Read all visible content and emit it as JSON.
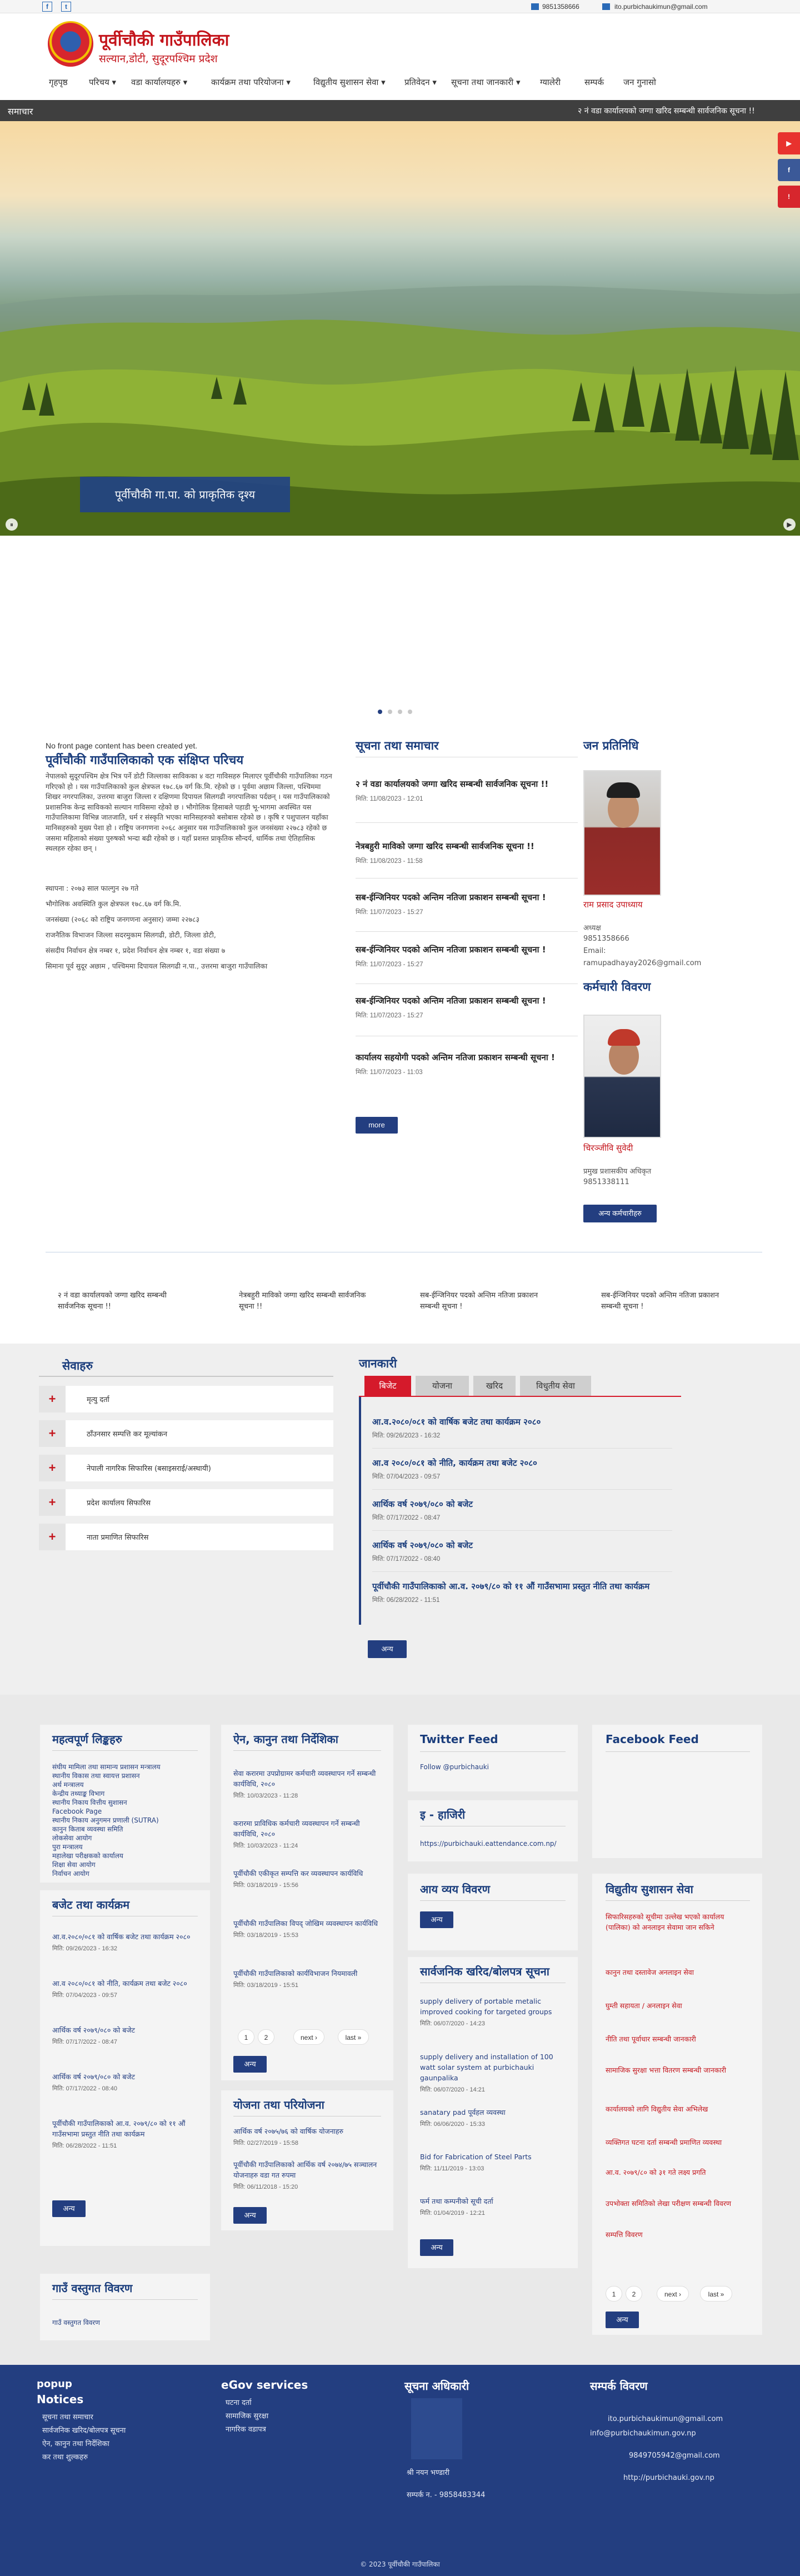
{
  "topbar": {
    "phone": "9851358666",
    "email": "ito.purbichaukimun@gmail.com"
  },
  "header": {
    "title": "पूर्वीचौकी गाउँपालिका",
    "subtitle": "सल्यान,डोटी, सुदूरपश्चिम प्रदेश"
  },
  "nav": [
    "गृहपृष्ठ",
    "परिचय ▾",
    "वडा कार्यालयहरु ▾",
    "कार्यक्रम तथा परियोजना ▾",
    "विद्युतीय सुशासन सेवा ▾",
    "प्रतिवेदन ▾",
    "सूचना तथा जानकारी ▾",
    "ग्यालेरी",
    "सम्पर्क",
    "जन गुनासो"
  ],
  "ticker": {
    "label": "समाचार",
    "text": "२ नं वडा कार्यालयको जग्गा खरिद सम्बन्धी सार्वजनिक सूचना !!"
  },
  "hero": {
    "caption": "पूर्वीचौकी गा.पा. को प्राकृतिक दृश्य"
  },
  "side_buttons": [
    "YouTube",
    "Facebook",
    "Alert"
  ],
  "intro": {
    "lead": "No front page content has been created yet.",
    "title": "पूर्वीचौकी गाउँपालिकाको एक संक्षिप्त परिचय",
    "body": "नेपालको सुदूरपश्चिम क्षेत्र भित्र पर्ने डोटी जिल्लाका साविकका ४ वटा गाविसहरु मिलाएर पूर्वीचौकी गाउँपालिका गठन गरिएको हो । यस गाउँपालिकाको कुल क्षेत्रफल १७८.६७ वर्ग कि.मि. रहेको छ । पूर्वमा अछाम जिल्ला, पश्चिममा शिखर नगरपालिका, उत्तरमा बाजुरा जिल्ला र दक्षिणमा दिपायल सिलगढी नगरपालिका पर्दछन् । यस गाउँपालिकाको प्रशासनिक केन्द्र साविकको सल्यान गाविसमा रहेको छ । भौगोलिक हिसाबले पहाडी भू-भागमा अवस्थित यस गाउँपालिकामा विभिन्न जातजाति, धर्म र संस्कृति भएका मानिसहरुको बसोबास रहेको छ । कृषि र पशुपालन यहाँका मानिसहरुको मुख्य पेशा हो । राष्ट्रिय जनगणना २०६८ अनुसार यस गाउँपालिकाको कुल जनसंख्या २२७८३ रहेको छ जसमा महिलाको संख्या पुरुषको भन्दा बढी रहेको छ । यहाँ प्रशस्त प्राकृतिक सौन्दर्य, धार्मिक तथा ऐतिहासिक स्थलहरु रहेका छन् ।",
    "lines": [
      "स्थापना : २०७३ साल फाल्गुन २७ गते",
      "भौगोलिक अवस्थिति कुल क्षेत्रफल १७८.६७ वर्ग कि.मि.",
      "जनसंख्या (२०६८ को राष्ट्रिय जनगणना अनुसार) जम्मा २२७८३",
      "राजनैतिक विभाजन जिल्ला सदरमुकाम सिलगढी, डोटी, जिल्ला डोटी,",
      "संसदीय निर्वाचन क्षेत्र नम्बर १, प्रदेश निर्वाचन क्षेत्र नम्बर १, वडा संख्या ७",
      "सिमाना पूर्व सुदूर अछाम , पश्चिममा दिपायल सिलगढी न.पा., उत्तरमा बाजुरा गाउँपालिका"
    ]
  },
  "news": {
    "heading": "सूचना तथा समाचार",
    "items": [
      {
        "title": "२ नं वडा कार्यालयको जग्गा खरिद सम्बन्धी सार्वजनिक सूचना !!",
        "date": "मिति: 11/08/2023 - 12:01"
      },
      {
        "title": "नेत्रबहुरी माविको जग्गा खरिद सम्बन्धी सार्वजनिक सूचना !!",
        "date": "मिति: 11/08/2023 - 11:58"
      },
      {
        "title": "सब-ईन्जिनियर पदको अन्तिम नतिजा प्रकाशन सम्बन्धी सूचना !",
        "date": "मिति: 11/07/2023 - 15:27"
      },
      {
        "title": "सब-ईन्जिनियर पदको अन्तिम नतिजा प्रकाशन सम्बन्धी सूचना !",
        "date": "मिति: 11/07/2023 - 15:27"
      },
      {
        "title": "सब-ईन्जिनियर पदको अन्तिम नतिजा प्रकाशन सम्बन्धी सूचना !",
        "date": "मिति: 11/07/2023 - 15:27"
      },
      {
        "title": "कार्यालय सहयोगी पदको अन्तिम नतिजा प्रकाशन सम्बन्धी सूचना !",
        "date": "मिति: 11/07/2023 - 11:03"
      }
    ],
    "more": "more"
  },
  "representative": {
    "heading": "जन प्रतिनिधि",
    "name": "राम प्रसाद उपाध्याय",
    "role": "अध्यक्ष",
    "phone": "9851358666",
    "email_label": "Email:",
    "email": "ramupadhayay2026@gmail.com"
  },
  "staff": {
    "heading": "कर्मचारी विवरण",
    "name": "चिरञ्जीवि सुवेदी",
    "role": "प्रमुख प्रशासकीय अधिकृत",
    "phone": "9851338111",
    "more": "अन्य कर्मचारीहरु"
  },
  "strip": [
    "२ नं वडा कार्यालयको जग्गा खरिद सम्बन्धी सार्वजनिक सूचना !!",
    "नेत्रबहुरी माविको जग्गा खरिद सम्बन्धी सार्वजनिक सूचना !!",
    "सब-ईन्जिनियर पदको अन्तिम नतिजा प्रकाशन सम्बन्धी सूचना !",
    "सब-ईन्जिनियर पदको अन्तिम नतिजा प्रकाशन सम्बन्धी सूचना !"
  ],
  "services": {
    "heading": "सेवाहरु",
    "items": [
      "मृत्यु दर्ता",
      "ठाँउनसार सम्पत्ति कर मूल्यांकन",
      "नेपाली नागरिक सिफारिस (बसाइसराई/अस्थायी)",
      "प्रदेश कार्यालय सिफारिस",
      "नाता प्रमाणित सिफारिस"
    ]
  },
  "info": {
    "heading": "जानकारी",
    "tabs": [
      "बिजेट",
      "योजना",
      "खरिद",
      "विधुतीय सेवा"
    ],
    "items": [
      {
        "title": "आ.व.२०८०/०८१ को वार्षिक बजेट तथा कार्यक्रम २०८०",
        "date": "मिति: 09/26/2023 - 16:32"
      },
      {
        "title": "आ.व २०८०/०८१ को नीति, कार्यक्रम तथा बजेट २०८०",
        "date": "मिति: 07/04/2023 - 09:57"
      },
      {
        "title": "आर्थिक वर्ष २०७९/०८० को बजेट",
        "date": "मिति: 07/17/2022 - 08:47"
      },
      {
        "title": "आर्थिक वर्ष २०७९/०८० को बजेट",
        "date": "मिति: 07/17/2022 - 08:40"
      },
      {
        "title": "पूर्वीचौकी गाउँपालिकाको आ.व. २०७९/८० को ११ औं गाउँसभामा प्रस्तुत नीति तथा कार्यक्रम",
        "date": "मिति: 06/28/2022 - 11:51"
      }
    ],
    "more": "अन्य"
  },
  "links_card": {
    "heading": "महत्वपूर्ण लिङ्कहरु",
    "items": [
      "संघीय मामिला तथा सामान्य प्रशासन मन्त्रालय",
      "स्थानीय विकास तथा स्वायत्त प्रशासन",
      "अर्थ मन्त्रालय",
      "केन्द्रीय तथ्याङ्क विभाग",
      "स्थानीय निकाय वित्तीय सुशासन",
      "Facebook Page",
      "स्थानीय निकाय अनुगमन प्रणाली (SUTRA)",
      "कानुन किताब व्यवस्था समिति",
      "लोकसेवा आयोग",
      "पुरा मन्त्रालय",
      "महालेखा परीक्षकको कार्यालय",
      "शिक्षा सेवा आयोग",
      "निर्वाचन आयोग"
    ]
  },
  "budget_card": {
    "heading": "बजेट तथा कार्यक्रम",
    "items": [
      {
        "title": "आ.व.२०८०/०८१ को वार्षिक बजेट तथा कार्यक्रम २०८०",
        "date": "मिति: 09/26/2023 - 16:32"
      },
      {
        "title": "आ.व २०८०/०८१ को नीति, कार्यक्रम तथा बजेट २०८०",
        "date": "मिति: 07/04/2023 - 09:57"
      },
      {
        "title": "आर्थिक वर्ष २०७९/०८० को बजेट",
        "date": "मिति: 07/17/2022 - 08:47"
      },
      {
        "title": "आर्थिक वर्ष २०७९/०८० को बजेट",
        "date": "मिति: 07/17/2022 - 08:40"
      },
      {
        "title": "पूर्वीचौकी गाउँपालिकाको आ.व. २०७९/८० को ११ औं गाउँसभामा प्रस्तुत नीति तथा कार्यक्रम",
        "date": "मिति: 06/28/2022 - 11:51"
      }
    ],
    "more": "अन्य"
  },
  "assets_card": {
    "heading": "गाउँ वस्तुगत विवरण",
    "link": "गाउँ वस्तुगत विवरण"
  },
  "law_card": {
    "heading": "ऐन, कानुन तथा निर्देशिका",
    "items": [
      {
        "title": "सेवा करारमा उपप्रोग्रामर कर्मचारी व्यवस्थापन गर्ने सम्बन्धी कार्यविधि, २०८०",
        "date": "मिति: 10/03/2023 - 11:28"
      },
      {
        "title": "करारमा प्राविधिक कर्मचारी व्यवस्थापन गर्ने सम्बन्धी कार्यविधि, २०८०",
        "date": "मिति: 10/03/2023 - 11:24"
      },
      {
        "title": "पूर्वीचौकी एकीकृत सम्पत्ति कर व्यवस्थापन कार्यविधि",
        "date": "मिति: 03/18/2019 - 15:56"
      },
      {
        "title": "पूर्वीचौकी गाउँपालिका विपद् जोखिम व्यवस्थापन कार्यविधि",
        "date": "मिति: 03/18/2019 - 15:53"
      },
      {
        "title": "पूर्वीचौकी गाउँपालिकाको कार्यविभाजन नियमावली",
        "date": "मिति: 03/18/2019 - 15:51"
      }
    ],
    "pager": [
      "1",
      "2",
      "next ›",
      "last »"
    ],
    "more": "अन्य"
  },
  "plans_card": {
    "heading": "योजना तथा परियोजना",
    "items": [
      {
        "title": "आर्थिक वर्ष २०७५/७६ को वार्षिक योजनाहरु",
        "date": "मिति: 02/27/2019 - 15:58"
      },
      {
        "title": "पूर्वीचौकी गाउँपालिकाको आर्थिक वर्ष २०७४/७५ सञ्चालन योजनाहरु वडा गत रुपमा",
        "date": "मिति: 06/11/2018 - 15:20"
      }
    ],
    "more": "अन्य"
  },
  "twitter_card": {
    "heading": "Twitter Feed",
    "link": "Follow @purbichauki"
  },
  "hajiri_card": {
    "heading": "इ - हाजिरी",
    "link": "https://purbichauki.eattendance.com.np/"
  },
  "income_card": {
    "heading": "आय व्यय विवरण",
    "more": "अन्य"
  },
  "procurement_card": {
    "heading": "सार्वजनिक खरिद/बोलपत्र सूचना",
    "items": [
      {
        "title": "supply delivery of portable metalic improved cooking for targeted groups",
        "date": "मिति: 06/07/2020 - 14:23"
      },
      {
        "title": "supply delivery and installation of 100 watt solar system at purbichauki gaunpalika",
        "date": "मिति: 06/07/2020 - 14:21"
      },
      {
        "title": "sanatary pad पूर्वहल व्यवस्था",
        "date": "मिति: 06/06/2020 - 15:33"
      },
      {
        "title": "Bid for Fabrication of Steel Parts",
        "date": "मिति: 11/11/2019 - 13:03"
      },
      {
        "title": "फर्म तथा कम्पनीको सूची दर्ता",
        "date": "मिति: 01/04/2019 - 12:21"
      }
    ],
    "more": "अन्य"
  },
  "facebook_card": {
    "heading": "Facebook Feed"
  },
  "egov_card": {
    "heading": "विद्युतीय सुशासन सेवा",
    "items": [
      "सिफारिसहरुको सूचीमा उल्लेख भएको कार्यालय (पालिका) को अनलाइन सेवामा जान सकिने",
      "कानुन तथा दस्तावेज अनलाइन सेवा",
      "घुम्ती सहायता / अनलाइन सेवा",
      "नीति तथा पूर्वाधार सम्बन्धी जानकारी",
      "सामाजिक सुरक्षा भत्ता वितरण सम्बन्धी जानकारी",
      "कार्यालयको लागि विद्युतीय सेवा अभिलेख",
      "व्यक्तिगत घटना दर्ता सम्बन्धी प्रमाणित व्यवस्था",
      "आ.व. २०७९/८० को ३१ गते लक्ष्य प्रगति",
      "उपभोक्ता समितिको लेखा परीक्षण सम्बन्धी विवरण",
      "सम्पत्ति विवरण"
    ],
    "pager": [
      "1",
      "2",
      "next ›",
      "last »"
    ],
    "more": "अन्य"
  },
  "footer": {
    "col1_heading": "popup",
    "col1_subheading": "Notices",
    "col1_links": [
      "सूचना तथा समाचार",
      "सार्वजनिक खरिद/बोलपत्र सूचना",
      "ऐन, कानुन तथा निर्देशिका",
      "कर तथा शुल्कहरु"
    ],
    "col2_heading": "eGov services",
    "col2_links": [
      "घटना दर्ता",
      "सामाजिक सुरक्षा",
      "नागरिक वडापत्र"
    ],
    "col3_heading": "सूचना अधिकारी",
    "col3_name": "श्री नयन भण्डारी",
    "col3_phone": "सम्पर्क न. - 9858483344",
    "col4_heading": "सम्पर्क विवरण",
    "col4_lines": [
      "ito.purbichaukimun@gmail.com",
      "info@purbichaukimun.gov.np",
      "9849705942@gmail.com",
      "http://purbichauki.gov.np"
    ],
    "copyright": "© 2023 पूर्वीचौकी गाउँपालिका"
  },
  "colors": {
    "navy": "#233e80",
    "brand_red": "#c4151c",
    "tab_red": "#d51a2b"
  }
}
